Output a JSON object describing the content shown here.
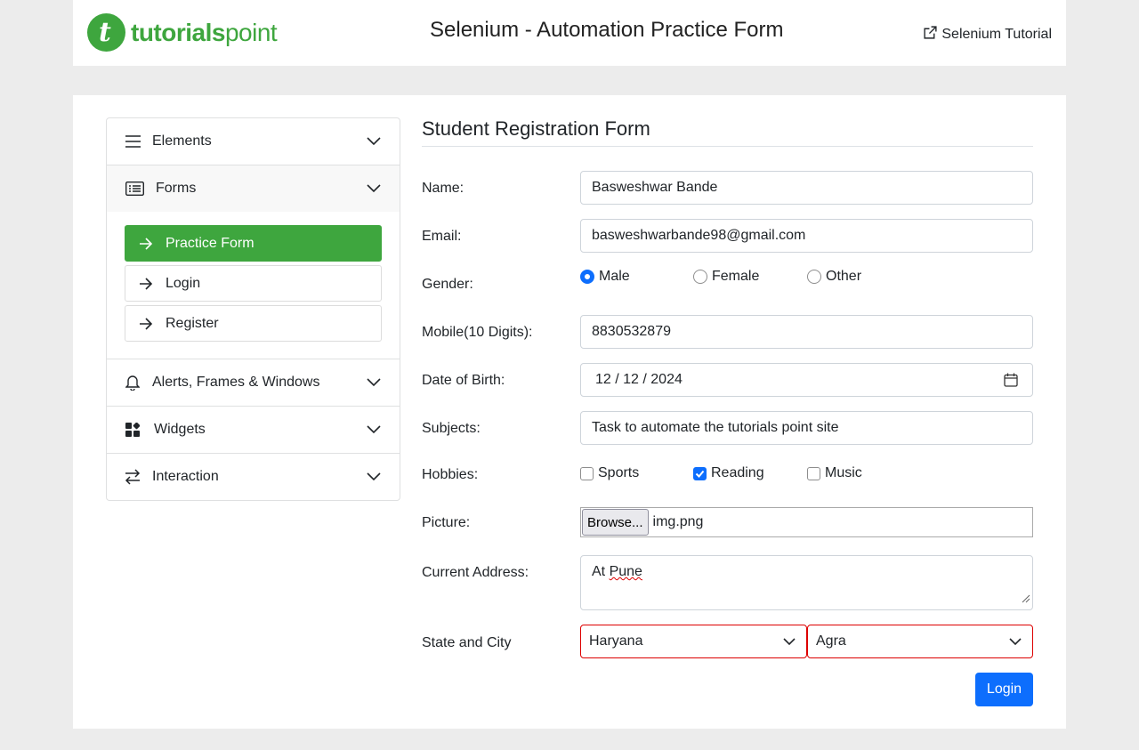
{
  "header": {
    "logo_part1": "tutorials",
    "logo_part2": "point",
    "title": "Selenium - Automation Practice Form",
    "link_label": "Selenium Tutorial",
    "link_icon": "external-link-icon"
  },
  "sidebar": {
    "sections": [
      {
        "label": "Elements",
        "icon": "menu-icon"
      },
      {
        "label": "Forms",
        "icon": "list-icon"
      },
      {
        "label": "Alerts, Frames & Windows",
        "icon": "bell-icon"
      },
      {
        "label": "Widgets",
        "icon": "widgets-icon"
      },
      {
        "label": "Interaction",
        "icon": "arrows-exchange-icon"
      }
    ],
    "forms_items": [
      {
        "label": "Practice Form",
        "active": true
      },
      {
        "label": "Login",
        "active": false
      },
      {
        "label": "Register",
        "active": false
      }
    ]
  },
  "form": {
    "title": "Student Registration Form",
    "name_label": "Name:",
    "name_value": "Basweshwar Bande",
    "email_label": "Email:",
    "email_value": "basweshwarbande98@gmail.com",
    "gender_label": "Gender:",
    "gender_options": [
      "Male",
      "Female",
      "Other"
    ],
    "gender_selected": "Male",
    "mobile_label": "Mobile(10 Digits):",
    "mobile_value": "8830532879",
    "dob_label": "Date of Birth:",
    "dob_value": "12 / 12 / 2024",
    "subjects_label": "Subjects:",
    "subjects_value": "Task to automate the tutorials point site",
    "hobbies_label": "Hobbies:",
    "hobbies_options": [
      "Sports",
      "Reading",
      "Music"
    ],
    "hobbies_checked": [
      "Reading"
    ],
    "picture_label": "Picture:",
    "browse_label": "Browse...",
    "picture_file": "img.png",
    "address_label": "Current Address:",
    "address_prefix": "At ",
    "address_word": "Pune",
    "state_city_label": "State and City",
    "state_value": "Haryana",
    "city_value": "Agra",
    "submit_label": "Login"
  },
  "colors": {
    "brand_green": "#3ea63e",
    "primary_blue": "#0d6efd",
    "invalid_red": "#dd0000"
  }
}
